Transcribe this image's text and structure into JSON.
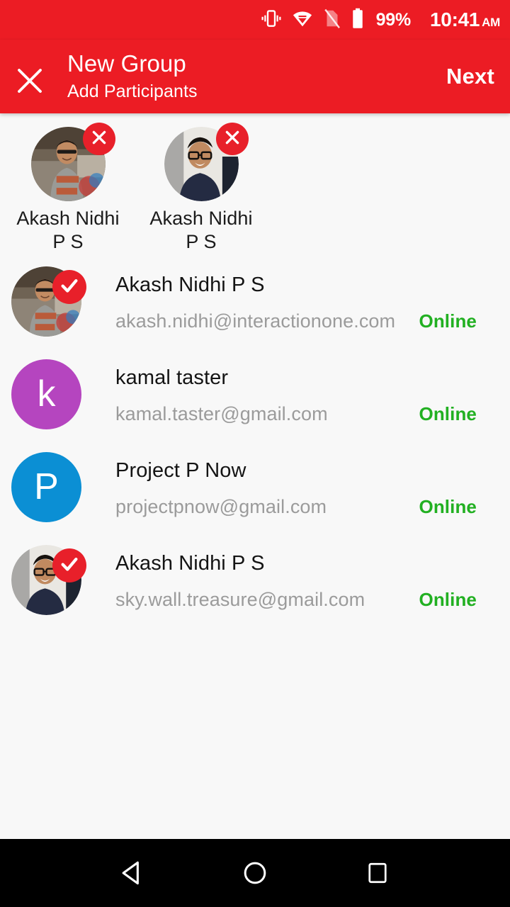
{
  "status_bar": {
    "battery_percent": "99%",
    "time": "10:41",
    "ampm": "AM",
    "icons": [
      "vibrate-icon",
      "wifi-icon",
      "sim-off-icon",
      "battery-icon"
    ],
    "background_color": "#ec1c24"
  },
  "app_bar": {
    "close_label": "close-icon",
    "title": "New Group",
    "subtitle": "Add Participants",
    "next_label": "Next",
    "background_color": "#ec1c24"
  },
  "selected_participants": [
    {
      "name": "Akash Nidhi P S",
      "avatar_type": "photo",
      "photo_variant": "a",
      "remove_icon": "close-icon"
    },
    {
      "name": "Akash Nidhi P S",
      "avatar_type": "photo",
      "photo_variant": "b",
      "remove_icon": "close-icon"
    }
  ],
  "contacts": [
    {
      "name": "Akash Nidhi P S",
      "email": "akash.nidhi@interactionone.com",
      "status": "Online",
      "status_color": "#22b022",
      "avatar_type": "photo",
      "photo_variant": "a",
      "avatar_letter": "",
      "avatar_color": "",
      "selected": true
    },
    {
      "name": "kamal taster",
      "email": "kamal.taster@gmail.com",
      "status": "Online",
      "status_color": "#22b022",
      "avatar_type": "letter",
      "photo_variant": "",
      "avatar_letter": "k",
      "avatar_color": "#b545bf",
      "selected": false
    },
    {
      "name": "Project P Now",
      "email": "projectpnow@gmail.com",
      "status": "Online",
      "status_color": "#22b022",
      "avatar_type": "letter",
      "photo_variant": "",
      "avatar_letter": "P",
      "avatar_color": "#0b8fd4",
      "selected": false
    },
    {
      "name": "Akash Nidhi P S",
      "email": "sky.wall.treasure@gmail.com",
      "status": "Online",
      "status_color": "#22b022",
      "avatar_type": "photo",
      "photo_variant": "b",
      "avatar_letter": "",
      "avatar_color": "",
      "selected": true
    }
  ],
  "nav_bar": {
    "back_label": "back-triangle-icon",
    "home_label": "home-circle-icon",
    "recents_label": "recents-square-icon",
    "background_color": "#000000"
  }
}
